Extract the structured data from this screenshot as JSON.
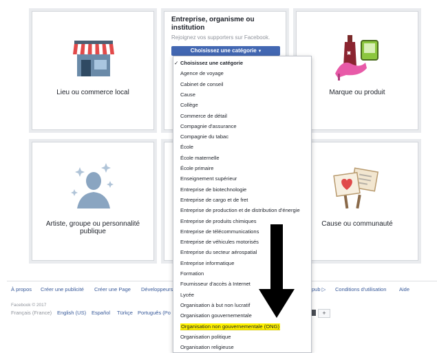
{
  "cards": {
    "local_business": "Lieu ou commerce local",
    "brand": "Marque ou produit",
    "artist": "Artiste, groupe ou personnalité publique",
    "cause": "Cause ou communauté"
  },
  "category_card": {
    "title": "Entreprise, organisme ou institution",
    "subtitle": "Rejoignez vos supporters sur Facebook.",
    "button_label": "Choisissez une catégorie",
    "caret": "▾"
  },
  "dropdown": {
    "check": "✓",
    "items": [
      "Choisissez une catégorie",
      "Agence de voyage",
      "Cabinet de conseil",
      "Cause",
      "Collège",
      "Commerce de détail",
      "Compagnie d'assurance",
      "Compagnie du tabac",
      "École",
      "École maternelle",
      "École primaire",
      "Enseignement supérieur",
      "Entreprise de biotechnologie",
      "Entreprise de cargo et de fret",
      "Entreprise de production et de distribution d'énergie",
      "Entreprise de produits chimiques",
      "Entreprise de télécommunications",
      "Entreprise de véhicules motorisés",
      "Entreprise du secteur aérospatial",
      "Entreprise informatique",
      "Formation",
      "Fournisseur d'accès à Internet",
      "Lycée",
      "Organisation à but non lucratif",
      "Organisation gouvernementale",
      "Organisation non gouvernementale (ONG)",
      "Organisation politique",
      "Organisation religieuse"
    ]
  },
  "footer": {
    "links": [
      "À propos",
      "Créer une publicité",
      "Créer une Page",
      "Développeurs",
      "pub",
      "Conditions d'utilisation",
      "Aide"
    ],
    "copyright": "Facebook © 2017",
    "languages": [
      "Français (France)",
      "English (US)",
      "Español",
      "Türkçe",
      "Português (Po"
    ],
    "plus": "+"
  },
  "colors": {
    "accent": "#4267b2",
    "highlight": "#fff200",
    "link": "#365899",
    "arrow": "#000000"
  }
}
